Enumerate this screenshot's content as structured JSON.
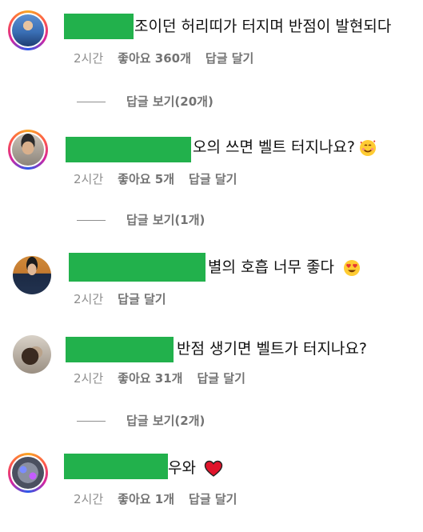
{
  "comments": [
    {
      "text": "조이던 허리띠가 터지며 반점이 발현되다",
      "time": "2시간",
      "likes": "좋아요 360개",
      "reply": "답글 달기",
      "view_replies": "답글 보기(20개)",
      "avatar_icon": "profile-photo-icon"
    },
    {
      "text": "오의 쓰면 벨트 터지나요?",
      "emoji": "smiling-face-with-hearts-icon",
      "time": "2시간",
      "likes": "좋아요 5개",
      "reply": "답글 달기",
      "view_replies": "답글 보기(1개)",
      "avatar_icon": "profile-photo-icon"
    },
    {
      "text": "별의 호흡 너무 좋다",
      "emoji": "heart-eyes-face-icon",
      "time": "2시간",
      "reply": "답글 달기",
      "avatar_icon": "profile-photo-icon"
    },
    {
      "text": "반점 생기면 벨트가 터지나요?",
      "time": "2시간",
      "likes": "좋아요 31개",
      "reply": "답글 달기",
      "view_replies": "답글 보기(2개)",
      "avatar_icon": "profile-photo-icon"
    },
    {
      "text": "우와",
      "emoji": "red-heart-icon",
      "time": "2시간",
      "likes": "좋아요 1개",
      "reply": "답글 달기",
      "avatar_icon": "profile-photo-icon"
    }
  ],
  "colors": {
    "redaction_green": "#22b14c",
    "meta_gray": "#737373",
    "story_ring": "#d6249f"
  }
}
